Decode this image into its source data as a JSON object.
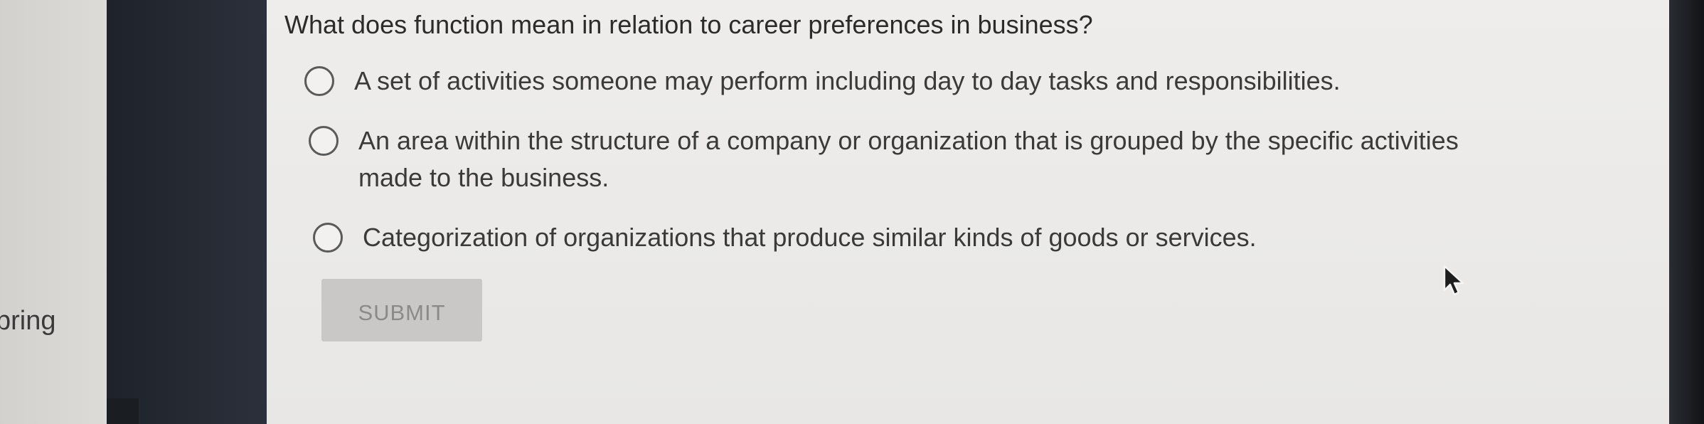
{
  "sidebar": {
    "partial_text": "pring"
  },
  "quiz": {
    "question": "What does function mean in relation to career preferences in business?",
    "options": [
      {
        "label": "A set of activities someone may perform including day to day tasks and responsibilities.",
        "selected": false
      },
      {
        "label": "An area within the structure of a company or organization that is grouped by the specific activities made to the business.",
        "selected": false
      },
      {
        "label": "Categorization of organizations that produce similar kinds of goods or services.",
        "selected": false
      }
    ],
    "submit_label": "SUBMIT",
    "submit_enabled": false
  },
  "colors": {
    "content_background": "#eeedeb",
    "dark_bar": "#232830",
    "button_disabled": "#c9c8c6",
    "text": "#2b2b2b"
  },
  "icons": {
    "radio": "radio-unchecked-icon",
    "cursor": "mouse-pointer-icon"
  }
}
